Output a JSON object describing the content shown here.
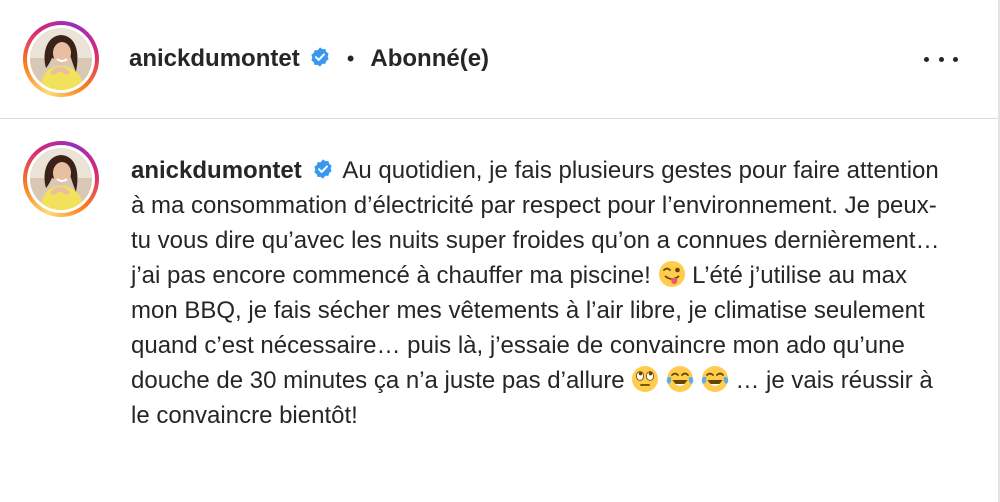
{
  "post_header": {
    "username": "anickdumontet",
    "separator": "•",
    "follow_status": "Abonné(e)",
    "more_icon": "more-horizontal-icon"
  },
  "caption": {
    "username": "anickdumontet",
    "text_part1": "Au quotidien, je fais plusieurs gestes pour faire attention à ma consommation d’électricité par respect pour l’environnement. Je peux-tu vous dire qu’avec les nuits super froides qu’on a connues dernièrement… j’ai pas encore commencé à chauffer ma piscine!",
    "text_part2": "L’été j’utilise au max mon BBQ, je fais sécher mes vêtements à l’air libre, je climatise seulement quand c’est nécessaire… puis là, j’essaie de convaincre mon ado qu’une douche de 30 minutes ça n’a juste pas d’allure",
    "text_part3": "… je vais réussir à le convaincre bientôt!",
    "emojis": [
      "winking-tongue-face-emoji",
      "eye-roll-face-emoji",
      "tears-of-joy-face-emoji",
      "tears-of-joy-face-emoji"
    ]
  },
  "colors": {
    "text": "#262626",
    "verified_badge": "#3897f0",
    "divider": "#dbdbdb",
    "ring_gradient": [
      "#feda75",
      "#fa7e1e",
      "#d62976",
      "#962fbf"
    ]
  }
}
